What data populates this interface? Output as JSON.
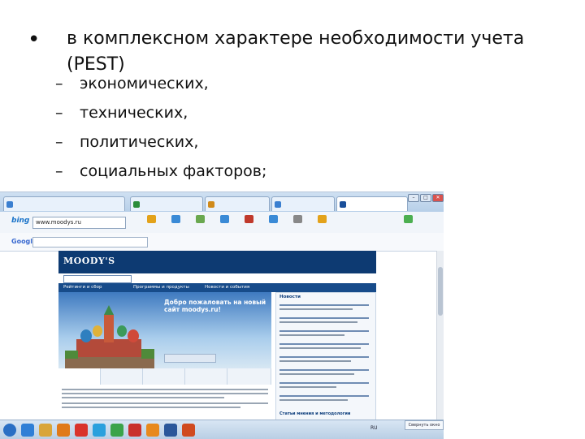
{
  "slide": {
    "bullet_symbol": "•",
    "main_text": "в комплексном характере необходимости учета  (PEST)",
    "dash_symbol": "–",
    "sub_items": [
      "экономических,",
      "технических,",
      "политических,",
      "социальных факторов;"
    ]
  },
  "browser": {
    "tabs": [
      {
        "icon_color": "#3a7fd0"
      },
      {
        "icon_color": "#2b8d3a"
      },
      {
        "icon_color": "#d08a1a"
      },
      {
        "icon_color": "#3a7fd0"
      },
      {
        "icon_color": "#1a4f9a"
      }
    ],
    "window_buttons": [
      "–",
      "□",
      "✕"
    ],
    "address_logo": "bing",
    "address_value": "www.moodys.ru",
    "google_logo": "Google",
    "taskbar_icons": [
      {
        "icon": "start-orb",
        "color": "#2a6fc4"
      },
      {
        "icon": "ie-icon",
        "color": "#2f7fd6"
      },
      {
        "icon": "explorer-icon",
        "color": "#d9a53a"
      },
      {
        "icon": "media-icon",
        "color": "#e07a1a"
      },
      {
        "icon": "yandex-icon",
        "color": "#d9332b"
      },
      {
        "icon": "skype-icon",
        "color": "#2aa0dd"
      },
      {
        "icon": "chrome-icon",
        "color": "#3aa34a"
      },
      {
        "icon": "pdf-icon",
        "color": "#c9302c"
      },
      {
        "icon": "vlc-icon",
        "color": "#e8891c"
      },
      {
        "icon": "word-icon",
        "color": "#2b579a"
      },
      {
        "icon": "ppt-icon",
        "color": "#d04a1f"
      }
    ],
    "tray_text": "RU",
    "tray_button": "Свернуть окно"
  },
  "moodys": {
    "logo": "MOODY'S",
    "nav": [
      "Рейтинги и сбор",
      "Программы и продукты",
      "Новости и события"
    ],
    "hero_title": "Добро пожаловать на новый сайт moodys.ru!",
    "news_title": "Новости",
    "news_footer": "Статьи мнения и методологии"
  }
}
